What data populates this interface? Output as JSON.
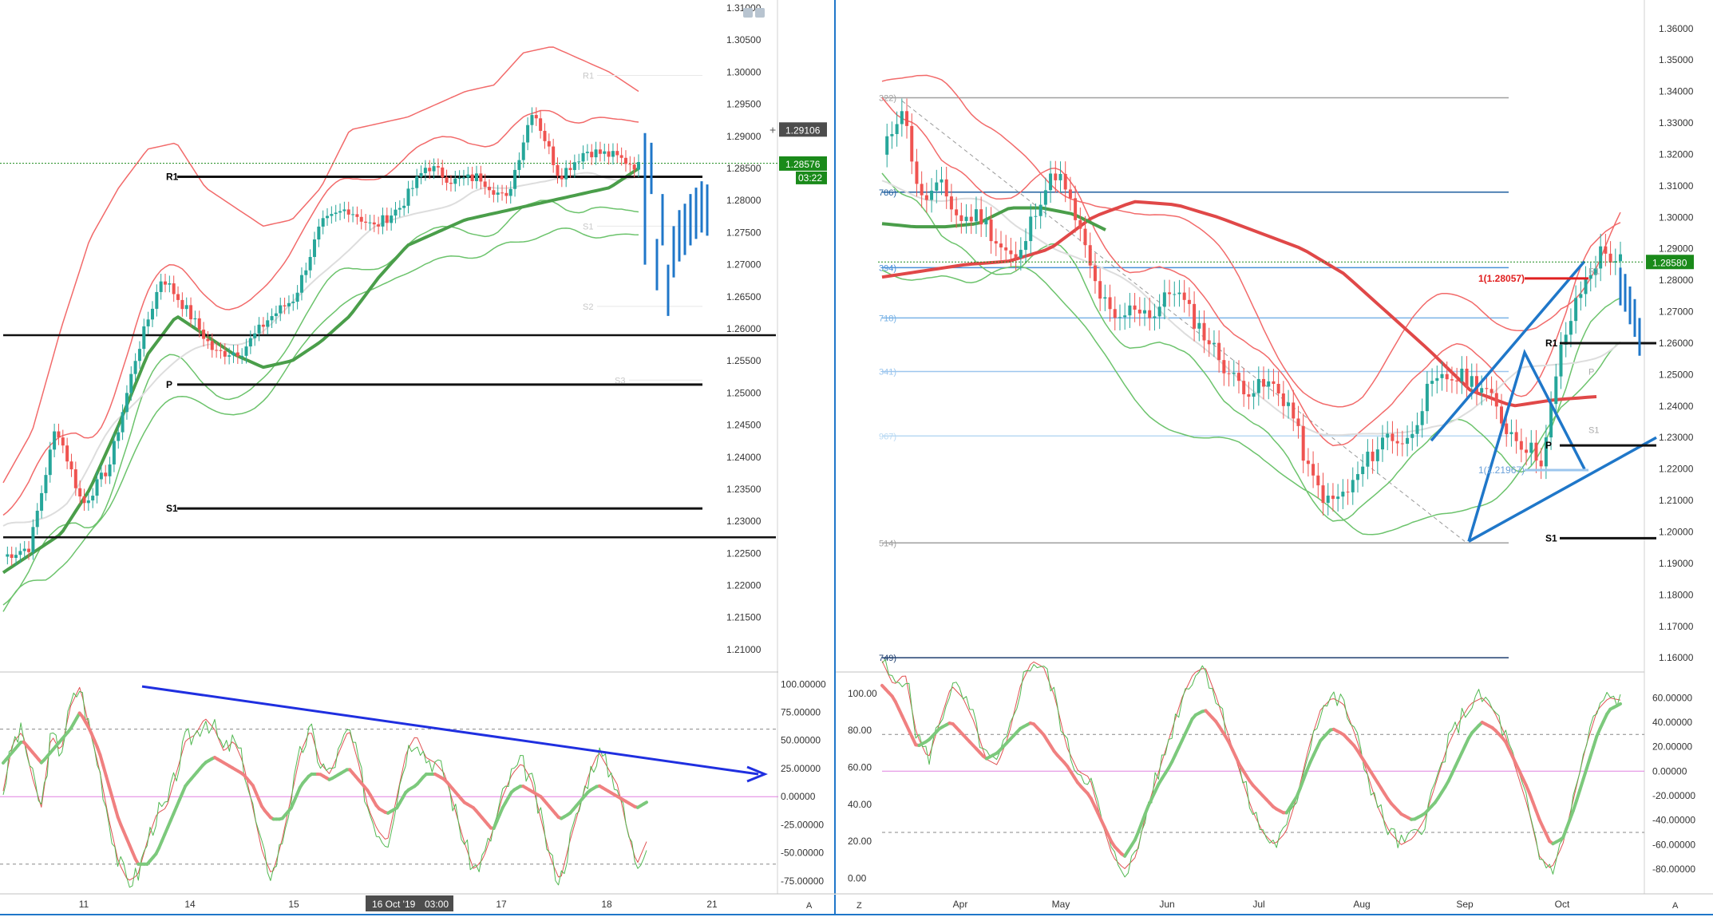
{
  "colors": {
    "up": "#26a69a",
    "down": "#ef5350",
    "band_red": "#f26a6a",
    "band_green": "#6cc36c",
    "ma_gray": "#dddddd",
    "blue": "#1f77c9",
    "badge_dark": "#4d4d4d",
    "badge_green": "#1a8a1a",
    "pivot": "#111111"
  },
  "left_chart": {
    "price_axis_labels": [
      "1.31000",
      "1.30500",
      "1.30000",
      "1.29500",
      "1.29000",
      "1.28500",
      "1.28000",
      "1.27500",
      "1.27000",
      "1.26500",
      "1.26000",
      "1.25500",
      "1.25000",
      "1.24500",
      "1.24000",
      "1.23500",
      "1.23000",
      "1.22500",
      "1.22000",
      "1.21500",
      "1.21000"
    ],
    "time_labels": [
      "11",
      "14",
      "15",
      "16 Oct '19",
      "03:00",
      "17",
      "18",
      "21"
    ],
    "price_badge": "1.29106",
    "last_price_badge": "1.28576",
    "countdown_badge": "03:22",
    "pivot_labels": {
      "r1": "R1",
      "p": "P",
      "s1": "S1"
    },
    "faint_labels": [
      "R1",
      "S1",
      "S2",
      "S3"
    ],
    "osc_axis_labels": [
      "100.00000",
      "75.00000",
      "50.00000",
      "25.00000",
      "0.00000",
      "-25.00000",
      "-50.00000",
      "-75.00000"
    ],
    "auto_label": "A"
  },
  "right_chart": {
    "price_axis_labels": [
      "1.36000",
      "1.35000",
      "1.34000",
      "1.33000",
      "1.32000",
      "1.31000",
      "1.30000",
      "1.29000",
      "1.28000",
      "1.27000",
      "1.26000",
      "1.25000",
      "1.24000",
      "1.23000",
      "1.22000",
      "1.21000",
      "1.20000",
      "1.19000",
      "1.18000",
      "1.17000",
      "1.16000"
    ],
    "time_labels": [
      "Apr",
      "May",
      "Jun",
      "Jul",
      "Aug",
      "Sep",
      "Oct"
    ],
    "last_price_badge": "1.28580",
    "target_label": "1(1.28057)",
    "second_target_label": "1(1.21967)",
    "fib_labels": [
      "322)",
      "786)",
      "394)",
      "718)",
      "341)",
      "967)",
      "514)",
      "749)"
    ],
    "pivot_labels": {
      "r1": "R1",
      "p": "P",
      "s1": "S1",
      "r1_small": "R1",
      "p_small": "P",
      "s1_small": "S1"
    },
    "osc_left_axis_labels": [
      "100.00",
      "80.00",
      "60.00",
      "40.00",
      "20.00",
      "0.00"
    ],
    "osc_axis_labels": [
      "60.00000",
      "40.00000",
      "20.00000",
      "0.00000",
      "-20.00000",
      "-40.00000",
      "-60.00000",
      "-80.00000"
    ],
    "z_label": "Z",
    "auto_label": "A"
  },
  "chart_data": [
    {
      "type": "line",
      "title": "",
      "timeframe_labels": [
        "11",
        "14",
        "15",
        "16",
        "17",
        "18",
        "21"
      ],
      "ylim": [
        1.208,
        1.311
      ],
      "series": [
        {
          "values": [
            1.2245,
            1.226,
            1.245,
            1.2325,
            1.2385,
            1.2555,
            1.2682,
            1.2625,
            1.2562,
            1.2565,
            1.2615,
            1.2648,
            1.2762,
            1.2788,
            1.2758,
            1.279,
            1.2855,
            1.283,
            1.2837,
            1.28,
            1.2945,
            1.2838,
            1.2878,
            1.287,
            1.2853
          ]
        },
        {
          "values": [
            1.23,
            1.238,
            1.254,
            1.268,
            1.276,
            1.282,
            1.283,
            1.276,
            1.273,
            1.27,
            1.271,
            1.276,
            1.285,
            1.286,
            1.287,
            1.289,
            1.291,
            1.292,
            1.297,
            1.298,
            1.296,
            1.294,
            1.291
          ]
        },
        {
          "values": [
            1.222,
            1.225,
            1.228,
            1.235,
            1.245,
            1.256,
            1.262,
            1.259,
            1.256,
            1.254,
            1.255,
            1.258,
            1.262,
            1.268,
            1.273,
            1.275,
            1.277,
            1.278,
            1.279,
            1.28,
            1.281,
            1.282,
            1.285
          ]
        }
      ],
      "pivots": {
        "R1": 1.2837,
        "P": 1.2513,
        "S1": 1.232,
        "level_upper": 1.259,
        "level_lower": 1.2275,
        "dotted_last": 1.2858
      },
      "forecast": {
        "start": 1.2855,
        "low": 1.266,
        "end": 1.2785
      },
      "oscillator": {
        "ylim": [
          -85,
          108
        ],
        "levels": [
          60,
          0,
          -60
        ],
        "fast": [
          5,
          48,
          58,
          18,
          -10,
          55,
          40,
          80,
          98,
          60,
          25,
          -20,
          -58,
          -75,
          -70,
          -40,
          -15,
          -10,
          20,
          50,
          55,
          70,
          60,
          40,
          50,
          30,
          -10,
          -50,
          -70,
          -40,
          0,
          40,
          60,
          30,
          20,
          40,
          60,
          30,
          -10,
          -30,
          -40,
          0,
          40,
          55,
          35,
          30,
          20,
          -10,
          -40,
          -65,
          -55,
          -30,
          0,
          20,
          30,
          15,
          -20,
          -55,
          -75,
          -40,
          -10,
          20,
          40,
          25,
          10,
          -30,
          -60,
          -40
        ],
        "slow": [
          30,
          40,
          50,
          40,
          30,
          40,
          50,
          60,
          75,
          60,
          40,
          10,
          -20,
          -40,
          -60,
          -60,
          -50,
          -30,
          -10,
          10,
          20,
          30,
          35,
          30,
          25,
          20,
          10,
          -10,
          -20,
          -20,
          -10,
          10,
          20,
          20,
          15,
          20,
          25,
          15,
          5,
          -10,
          -15,
          -10,
          5,
          10,
          20,
          20,
          15,
          5,
          -5,
          -10,
          -20,
          -30,
          -10,
          5,
          10,
          5,
          0,
          -10,
          -20,
          -15,
          -5,
          5,
          10,
          5,
          0,
          -5,
          -10,
          -5
        ],
        "trendline": {
          "start": 98,
          "end": 20
        }
      }
    },
    {
      "type": "line",
      "title": "",
      "x": [
        "Apr",
        "May",
        "Jun",
        "Jul",
        "Aug",
        "Sep",
        "Oct"
      ],
      "ylim": [
        1.157,
        1.364
      ],
      "series": [
        {
          "values": [
            1.319,
            1.336,
            1.305,
            1.31,
            1.299,
            1.301,
            1.2915,
            1.2855,
            1.305,
            1.315,
            1.299,
            1.278,
            1.266,
            1.272,
            1.269,
            1.278,
            1.268,
            1.259,
            1.249,
            1.245,
            1.247,
            1.24,
            1.218,
            1.209,
            1.213,
            1.223,
            1.231,
            1.228,
            1.244,
            1.249,
            1.249,
            1.246,
            1.234,
            1.228,
            1.223,
            1.26,
            1.277,
            1.289,
            1.286
          ]
        },
        {
          "values": [
            1.281,
            1.283,
            1.285,
            1.286,
            1.29,
            1.3,
            1.305,
            1.304,
            1.3,
            1.295,
            1.29,
            1.282,
            1.27,
            1.258,
            1.245,
            1.24,
            1.242,
            1.243
          ]
        },
        {
          "values": [
            1.298,
            1.297,
            1.297,
            1.298,
            1.303,
            1.303,
            1.301,
            1.296,
            1.288,
            1.278,
            1.266,
            1.258,
            1.255,
            1.25,
            1.246,
            1.243,
            1.242,
            1.24,
            1.241
          ]
        }
      ],
      "fibonacci": {
        "322)": 1.338,
        "786)": 1.308,
        "394)": 1.284,
        "718)": 1.268,
        "341)": 1.251,
        "967)": 1.2305,
        "514)": 1.1965,
        "749)": 1.16
      },
      "pivots": {
        "R1": 1.26,
        "P": 1.2275,
        "S1": 1.198
      },
      "targets": {
        "1(1.28057)": 1.28057,
        "1(1.21967)": 1.21967
      },
      "oscillator": {
        "left_ylim": [
          -5,
          103
        ],
        "right_ylim": [
          -95,
          68
        ],
        "levels": [
          30,
          0,
          -50
        ],
        "fast": [
          90,
          70,
          80,
          30,
          10,
          40,
          70,
          60,
          40,
          10,
          5,
          30,
          70,
          90,
          85,
          60,
          20,
          0,
          -5,
          -40,
          -70,
          -80,
          -70,
          -30,
          0,
          30,
          60,
          80,
          85,
          60,
          30,
          0,
          -30,
          -50,
          -60,
          -50,
          -20,
          20,
          50,
          60,
          55,
          30,
          0,
          -30,
          -50,
          -60,
          -55,
          -40,
          -10,
          20,
          40,
          55,
          60,
          50,
          30,
          0,
          -30,
          -70,
          -80,
          -60,
          -20,
          20,
          50,
          60,
          58
        ],
        "slow": [
          70,
          60,
          40,
          20,
          25,
          35,
          40,
          30,
          20,
          10,
          15,
          25,
          35,
          40,
          30,
          15,
          5,
          -10,
          -20,
          -40,
          -60,
          -70,
          -55,
          -30,
          -10,
          5,
          25,
          45,
          50,
          40,
          25,
          5,
          -10,
          -20,
          -30,
          -35,
          -20,
          5,
          25,
          35,
          30,
          20,
          5,
          -10,
          -25,
          -35,
          -40,
          -35,
          -25,
          -10,
          10,
          30,
          40,
          35,
          25,
          5,
          -15,
          -40,
          -60,
          -55,
          -30,
          0,
          30,
          50,
          55
        ]
      }
    }
  ]
}
